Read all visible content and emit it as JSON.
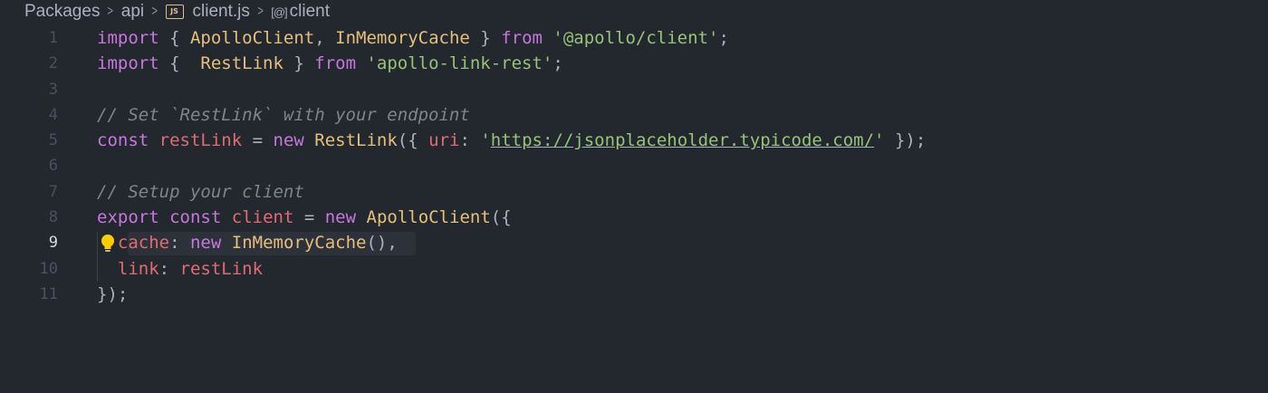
{
  "breadcrumb": {
    "items": [
      "Packages",
      "api",
      "client.js",
      "client"
    ],
    "js_badge": "JS",
    "symbol_icon_glyph": "[@]"
  },
  "editor": {
    "active_line": 9,
    "line_numbers": [
      "1",
      "2",
      "3",
      "4",
      "5",
      "6",
      "7",
      "8",
      "9",
      "10",
      "11"
    ],
    "lines": [
      [
        [
          "kw",
          "import"
        ],
        [
          "p",
          " { "
        ],
        [
          "cls",
          "ApolloClient"
        ],
        [
          "p",
          ", "
        ],
        [
          "cls",
          "InMemoryCache"
        ],
        [
          "p",
          " } "
        ],
        [
          "kw",
          "from"
        ],
        [
          "p",
          " "
        ],
        [
          "str",
          "'@apollo/client'"
        ],
        [
          "p",
          ";"
        ]
      ],
      [
        [
          "kw",
          "import"
        ],
        [
          "p",
          " {  "
        ],
        [
          "cls",
          "RestLink"
        ],
        [
          "p",
          " } "
        ],
        [
          "kw",
          "from"
        ],
        [
          "p",
          " "
        ],
        [
          "str",
          "'apollo-link-rest'"
        ],
        [
          "p",
          ";"
        ]
      ],
      [],
      [
        [
          "com",
          "// Set `RestLink` with your endpoint"
        ]
      ],
      [
        [
          "kw",
          "const"
        ],
        [
          "p",
          " "
        ],
        [
          "var",
          "restLink"
        ],
        [
          "p",
          " = "
        ],
        [
          "kw",
          "new"
        ],
        [
          "p",
          " "
        ],
        [
          "cls",
          "RestLink"
        ],
        [
          "p",
          "({ "
        ],
        [
          "var",
          "uri"
        ],
        [
          "p",
          ": "
        ],
        [
          "str",
          "'"
        ],
        [
          "url",
          "https://jsonplaceholder.typicode.com/"
        ],
        [
          "str",
          "'"
        ],
        [
          "p",
          " });"
        ]
      ],
      [],
      [
        [
          "com",
          "// Setup your client"
        ]
      ],
      [
        [
          "kw",
          "export"
        ],
        [
          "p",
          " "
        ],
        [
          "kw",
          "const"
        ],
        [
          "p",
          " "
        ],
        [
          "var",
          "client"
        ],
        [
          "p",
          " = "
        ],
        [
          "kw",
          "new"
        ],
        [
          "p",
          " "
        ],
        [
          "cls",
          "ApolloClient"
        ],
        [
          "p",
          "({"
        ]
      ],
      [
        [
          "p",
          "  "
        ],
        [
          "var",
          "cache"
        ],
        [
          "p",
          ": "
        ],
        [
          "kw",
          "new"
        ],
        [
          "p",
          " "
        ],
        [
          "cls",
          "InMemoryCache"
        ],
        [
          "p",
          "(),"
        ]
      ],
      [
        [
          "p",
          "  "
        ],
        [
          "var",
          "link"
        ],
        [
          "p",
          ": "
        ],
        [
          "var",
          "restLink"
        ]
      ],
      [
        [
          "p",
          "});"
        ]
      ]
    ]
  },
  "colors": {
    "background": "#23272e",
    "keyword": "#c678dd",
    "class": "#e5c07b",
    "variable": "#e06c75",
    "string": "#98c379",
    "comment": "#7f848e",
    "punctuation": "#abb2bf",
    "lightbulb": "#ffcc00"
  },
  "icons": {
    "separator": "chevron-right-icon",
    "file": "javascript-file-icon",
    "symbol": "symbol-variable-icon",
    "lightbulb": "lightbulb-icon"
  }
}
